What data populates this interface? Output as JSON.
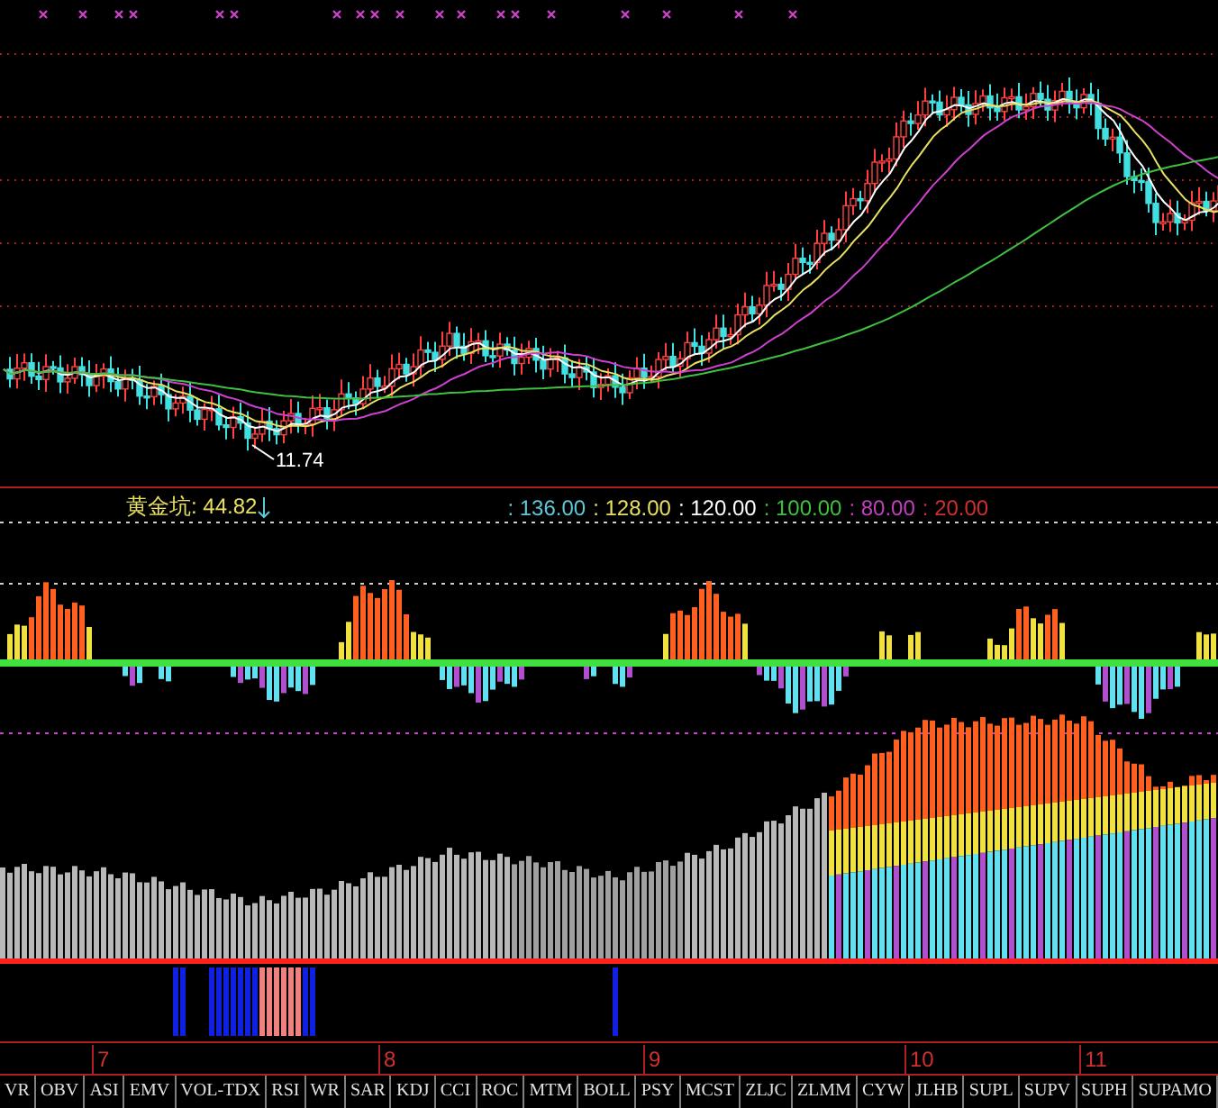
{
  "main_chart": {
    "low_label": "11.74"
  },
  "indicator": {
    "name": "黄金坑: 44.82",
    "levels": [
      {
        "text": ": 136.00",
        "color": "#5fc8d8"
      },
      {
        "text": ": 128.00",
        "color": "#e8e060"
      },
      {
        "text": ": 120.00",
        "color": "#ffffff"
      },
      {
        "text": ": 100.00",
        "color": "#40c040"
      },
      {
        "text": ": 80.00",
        "color": "#c040c0"
      },
      {
        "text": ": 20.00",
        "color": "#d03030"
      }
    ]
  },
  "x_axis": [
    "7",
    "8",
    "9",
    "10",
    "11"
  ],
  "tabs": [
    "VR",
    "OBV",
    "ASI",
    "EMV",
    "VOL-TDX",
    "RSI",
    "WR",
    "SAR",
    "KDJ",
    "CCI",
    "ROC",
    "MTM",
    "BOLL",
    "PSY",
    "MCST",
    "ZLJC",
    "ZLMM",
    "CYW",
    "JLHB",
    "SUPL",
    "SUPV",
    "SUPH",
    "SUPAMO"
  ]
}
